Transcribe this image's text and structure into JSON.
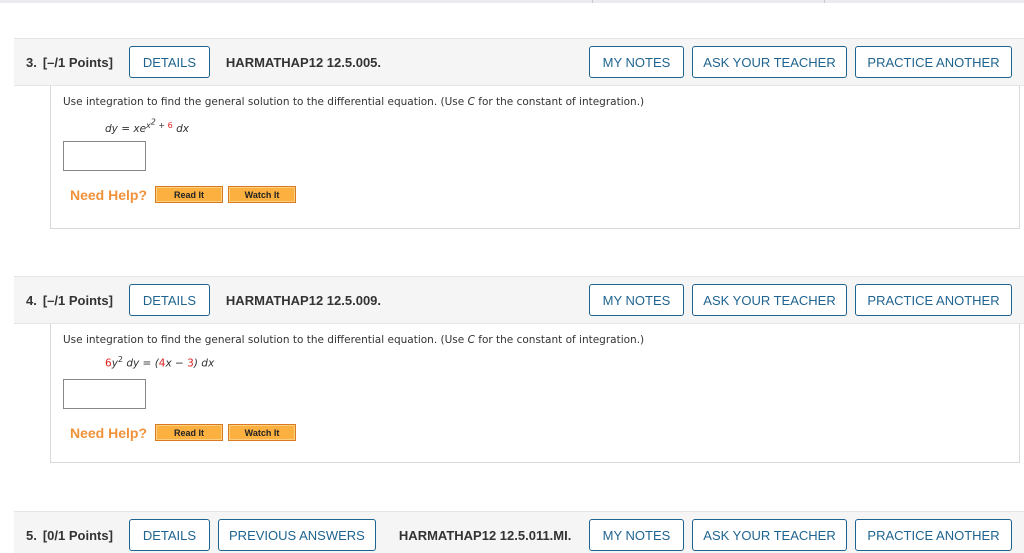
{
  "questions": [
    {
      "number": "3.",
      "points": "[–/1 Points]",
      "details_label": "DETAILS",
      "previous_answers_label": null,
      "code": "HARMATHAP12 12.5.005.",
      "my_notes_label": "MY NOTES",
      "ask_teacher_label": "ASK YOUR TEACHER",
      "practice_another_label": "PRACTICE ANOTHER",
      "prompt_before": "Use integration to find the general solution to the differential equation. (Use ",
      "prompt_var": "C",
      "prompt_after": " for the constant of integration.)",
      "equation": {
        "lhs": "dy = xe",
        "exp_base": "x",
        "exp_power": "2",
        "exp_plus": " + ",
        "exp_const": "6",
        "rhs": " dx"
      },
      "answer_value": "",
      "need_help_label": "Need Help?",
      "read_it_label": "Read It",
      "watch_it_label": "Watch It"
    },
    {
      "number": "4.",
      "points": "[–/1 Points]",
      "details_label": "DETAILS",
      "code": "HARMATHAP12 12.5.009.",
      "my_notes_label": "MY NOTES",
      "ask_teacher_label": "ASK YOUR TEACHER",
      "practice_another_label": "PRACTICE ANOTHER",
      "prompt_before": "Use integration to find the general solution to the differential equation. (Use ",
      "prompt_var": "C",
      "prompt_after": " for the constant of integration.)",
      "equation": {
        "coef1": "6",
        "part1": "y",
        "power": "2",
        "part2": " dy = (",
        "coef2": "4",
        "part3": "x − ",
        "const": "3",
        "part4": ") dx"
      },
      "answer_value": "",
      "need_help_label": "Need Help?",
      "read_it_label": "Read It",
      "watch_it_label": "Watch It"
    },
    {
      "number": "5.",
      "points": "[0/1 Points]",
      "details_label": "DETAILS",
      "previous_answers_label": "PREVIOUS ANSWERS",
      "code": "HARMATHAP12 12.5.011.MI.",
      "my_notes_label": "MY NOTES",
      "ask_teacher_label": "ASK YOUR TEACHER",
      "practice_another_label": "PRACTICE ANOTHER"
    }
  ],
  "colors": {
    "button_accent": "#1f6490",
    "need_help": "#f0923a",
    "help_button_fill": "#fbb040",
    "equation_highlight": "#e02020"
  }
}
